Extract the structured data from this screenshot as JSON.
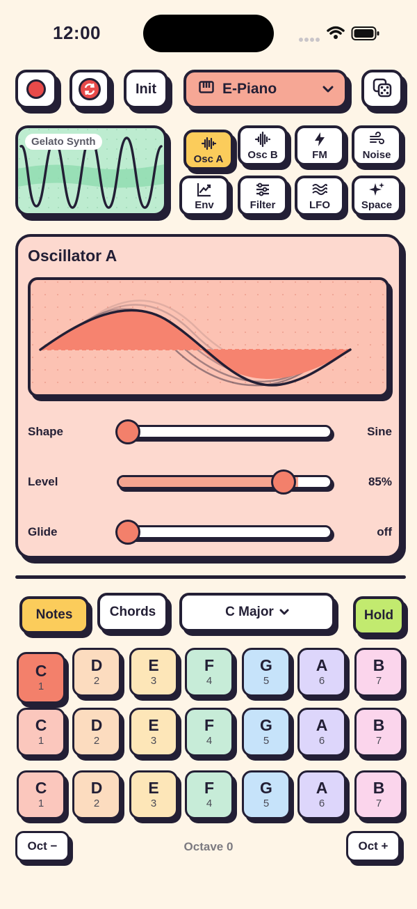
{
  "status": {
    "time": "12:00"
  },
  "toolbar": {
    "record_icon": "record-icon",
    "loop_icon": "loop-icon",
    "init_label": "Init",
    "preset_name": "E-Piano",
    "random_icon": "dice-icon"
  },
  "waveform": {
    "tag": "Gelato Synth"
  },
  "tabs": [
    {
      "label": "Osc A",
      "icon": "waveform-icon",
      "active": true
    },
    {
      "label": "Osc B",
      "icon": "wave-burst-icon",
      "active": false
    },
    {
      "label": "FM",
      "icon": "bolt-icon",
      "active": false
    },
    {
      "label": "Noise",
      "icon": "wind-icon",
      "active": false
    },
    {
      "label": "Env",
      "icon": "chart-line-icon",
      "active": false
    },
    {
      "label": "Filter",
      "icon": "sliders-icon",
      "active": false
    },
    {
      "label": "LFO",
      "icon": "water-icon",
      "active": false
    },
    {
      "label": "Space",
      "icon": "sparkles-icon",
      "active": false
    }
  ],
  "oscillator": {
    "title": "Oscillator A",
    "params": [
      {
        "label": "Shape",
        "value": "Sine",
        "level": 0.0
      },
      {
        "label": "Level",
        "value": "85%",
        "level": 0.85
      },
      {
        "label": "Glide",
        "value": "off",
        "level": 0.0
      }
    ]
  },
  "keyboard": {
    "modes": {
      "notes": "Notes",
      "chords": "Chords"
    },
    "scale": "C Major",
    "hold": "Hold",
    "rows": [
      [
        {
          "n": "C",
          "d": "1"
        },
        {
          "n": "D",
          "d": "2"
        },
        {
          "n": "E",
          "d": "3"
        },
        {
          "n": "F",
          "d": "4"
        },
        {
          "n": "G",
          "d": "5"
        },
        {
          "n": "A",
          "d": "6"
        },
        {
          "n": "B",
          "d": "7"
        }
      ],
      [
        {
          "n": "C",
          "d": "1"
        },
        {
          "n": "D",
          "d": "2"
        },
        {
          "n": "E",
          "d": "3"
        },
        {
          "n": "F",
          "d": "4"
        },
        {
          "n": "G",
          "d": "5"
        },
        {
          "n": "A",
          "d": "6"
        },
        {
          "n": "B",
          "d": "7"
        }
      ],
      [
        {
          "n": "C",
          "d": "1"
        },
        {
          "n": "D",
          "d": "2"
        },
        {
          "n": "E",
          "d": "3"
        },
        {
          "n": "F",
          "d": "4"
        },
        {
          "n": "G",
          "d": "5"
        },
        {
          "n": "A",
          "d": "6"
        },
        {
          "n": "B",
          "d": "7"
        }
      ]
    ],
    "key_colors": [
      "#fbc7bd",
      "#fcdcbf",
      "#fde6b8",
      "#c7ecd8",
      "#c6e3fa",
      "#ddd6fb",
      "#fbd5ec"
    ],
    "active_key_color": "#f3806b",
    "octave_down": "Oct −",
    "octave_up": "Oct +",
    "octave_label": "Octave 0"
  }
}
